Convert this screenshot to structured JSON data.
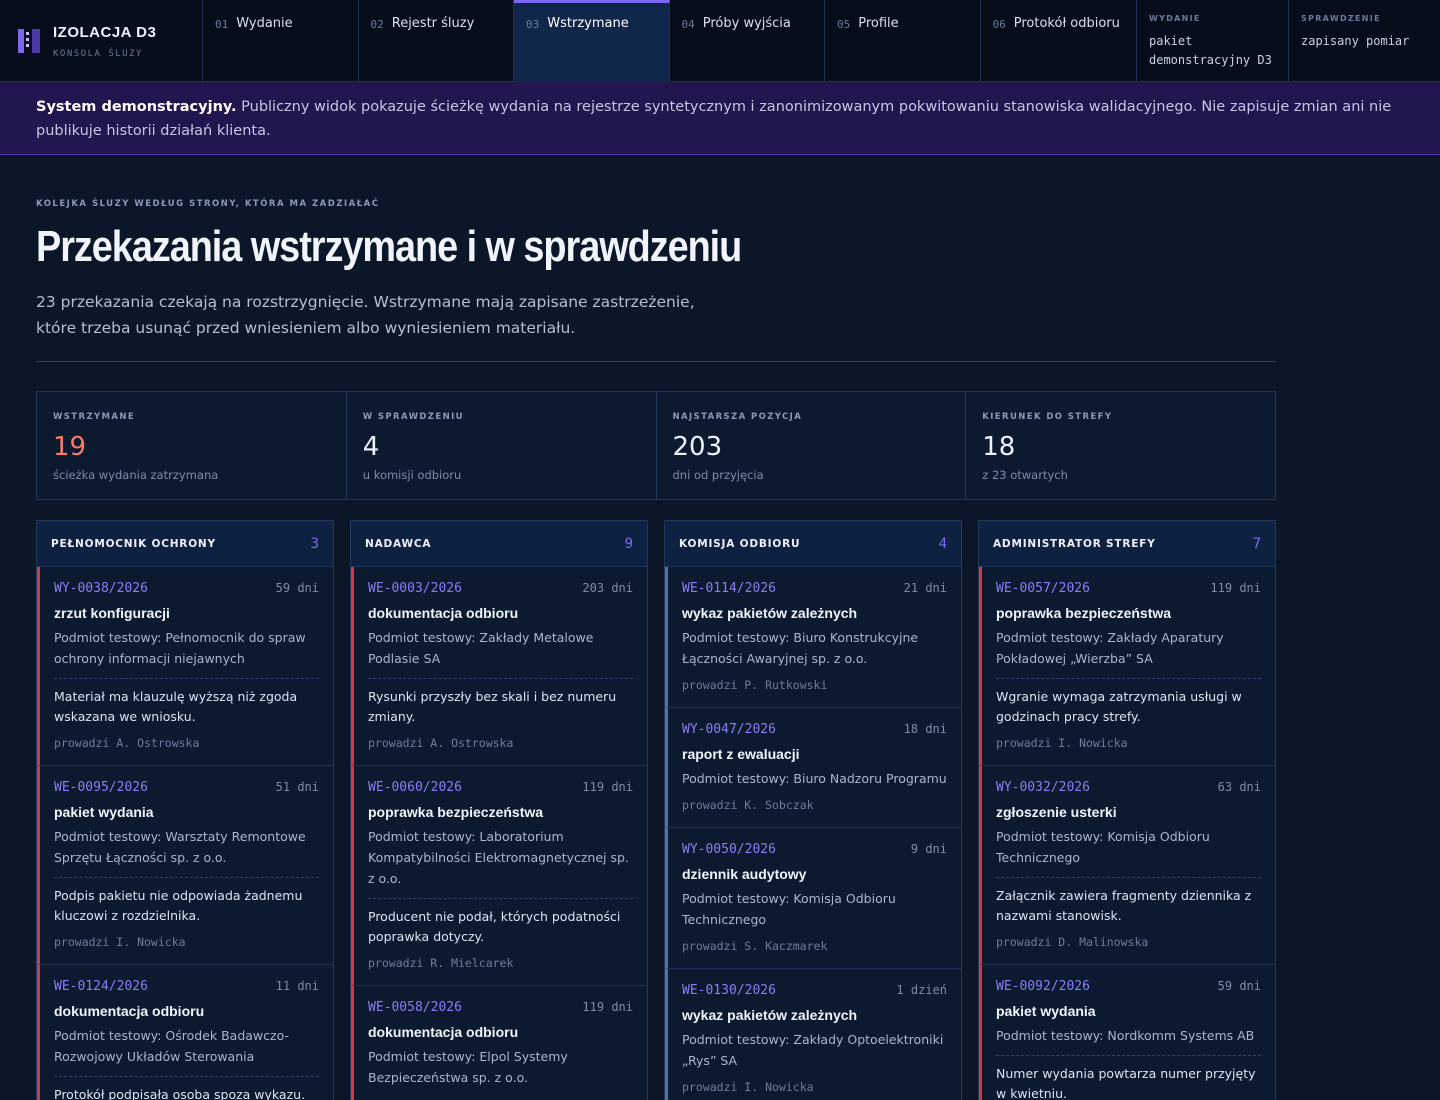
{
  "app": {
    "title": "IZOLACJA D3",
    "subtitle": "KONSOLA ŚLUZY"
  },
  "nav": {
    "tabs": [
      {
        "num": "01",
        "label": "Wydanie",
        "active": false
      },
      {
        "num": "02",
        "label": "Rejestr śluzy",
        "active": false
      },
      {
        "num": "03",
        "label": "Wstrzymane",
        "active": true
      },
      {
        "num": "04",
        "label": "Próby wyjścia",
        "active": false
      },
      {
        "num": "05",
        "label": "Profile",
        "active": false
      },
      {
        "num": "06",
        "label": "Protokół odbioru",
        "active": false
      }
    ],
    "release": {
      "label": "WYDANIE",
      "value_line1": "pakiet",
      "value_line2": "demonstracyjny D3"
    },
    "check": {
      "label": "SPRAWDZENIE",
      "value": "zapisany pomiar"
    }
  },
  "banner": {
    "strong": "System demonstracyjny.",
    "text": " Publiczny widok pokazuje ścieżkę wydania na rejestrze syntetycznym i zanonimizowanym pokwitowaniu stanowiska walidacyjnego. Nie zapisuje zmian ani nie publikuje historii działań klienta."
  },
  "page": {
    "eyebrow": "KOLEJKA ŚLUZY WEDŁUG STRONY, KTÓRA MA ZADZIAŁAĆ",
    "title": "Przekazania wstrzymane i w sprawdzeniu",
    "lead": "23 przekazania czekają na rozstrzygnięcie. Wstrzymane mają zapisane zastrzeżenie, które trzeba usunąć przed wniesieniem albo wyniesieniem materiału."
  },
  "stats": [
    {
      "label": "WSTRZYMANE",
      "value": "19",
      "sub": "ścieżka wydania zatrzymana"
    },
    {
      "label": "W SPRAWDZENIU",
      "value": "4",
      "sub": "u komisji odbioru"
    },
    {
      "label": "NAJSTARSZA POZYCJA",
      "value": "203",
      "sub": "dni od przyjęcia"
    },
    {
      "label": "KIERUNEK DO STREFY",
      "value": "18",
      "sub": "z 23 otwartych"
    }
  ],
  "columns": [
    {
      "name": "PEŁNOMOCNIK OCHRONY",
      "count": "3",
      "cards": [
        {
          "id": "WY-0038/2026",
          "age": "59 dni",
          "title": "zrzut konfiguracji",
          "subject": "Podmiot testowy: Pełnomocnik do spraw ochrony informacji niejawnych",
          "note": "Materiał ma klauzulę wyższą niż zgoda wskazana we wniosku.",
          "owner": "prowadzi A. Ostrowska"
        },
        {
          "id": "WE-0095/2026",
          "age": "51 dni",
          "title": "pakiet wydania",
          "subject": "Podmiot testowy: Warsztaty Remontowe Sprzętu Łączności sp. z o.o.",
          "note": "Podpis pakietu nie odpowiada żadnemu kluczowi z rozdzielnika.",
          "owner": "prowadzi I. Nowicka"
        },
        {
          "id": "WE-0124/2026",
          "age": "11 dni",
          "title": "dokumentacja odbioru",
          "subject": "Podmiot testowy: Ośrodek Badawczo-Rozwojowy Układów Sterowania",
          "note": "Protokół podpisała osoba spoza wykazu.",
          "owner": ""
        }
      ]
    },
    {
      "name": "NADAWCA",
      "count": "9",
      "cards": [
        {
          "id": "WE-0003/2026",
          "age": "203 dni",
          "title": "dokumentacja odbioru",
          "subject": "Podmiot testowy: Zakłady Metalowe Podlasie SA",
          "note": "Rysunki przyszły bez skali i bez numeru zmiany.",
          "owner": "prowadzi A. Ostrowska"
        },
        {
          "id": "WE-0060/2026",
          "age": "119 dni",
          "title": "poprawka bezpieczeństwa",
          "subject": "Podmiot testowy: Laboratorium Kompatybilności Elektromagnetycznej sp. z o.o.",
          "note": "Producent nie podał, których podatności poprawka dotyczy.",
          "owner": "prowadzi R. Mielcarek"
        },
        {
          "id": "WE-0058/2026",
          "age": "119 dni",
          "title": "dokumentacja odbioru",
          "subject": "Podmiot testowy: Elpol Systemy Bezpieczeństwa sp. z o.o.",
          "note": "",
          "owner": ""
        }
      ]
    },
    {
      "name": "KOMISJA ODBIORU",
      "count": "4",
      "cards": [
        {
          "id": "WE-0114/2026",
          "age": "21 dni",
          "title": "wykaz pakietów zależnych",
          "subject": "Podmiot testowy: Biuro Konstrukcyjne Łączności Awaryjnej sp. z o.o.",
          "note": "",
          "owner": "prowadzi P. Rutkowski"
        },
        {
          "id": "WY-0047/2026",
          "age": "18 dni",
          "title": "raport z ewaluacji",
          "subject": "Podmiot testowy: Biuro Nadzoru Programu",
          "note": "",
          "owner": "prowadzi K. Sobczak"
        },
        {
          "id": "WY-0050/2026",
          "age": "9 dni",
          "title": "dziennik audytowy",
          "subject": "Podmiot testowy: Komisja Odbioru Technicznego",
          "note": "",
          "owner": "prowadzi S. Kaczmarek"
        },
        {
          "id": "WE-0130/2026",
          "age": "1 dzień",
          "title": "wykaz pakietów zależnych",
          "subject": "Podmiot testowy: Zakłady Optoelektroniki „Rys” SA",
          "note": "",
          "owner": "prowadzi I. Nowicka"
        }
      ]
    },
    {
      "name": "ADMINISTRATOR STREFY",
      "count": "7",
      "cards": [
        {
          "id": "WE-0057/2026",
          "age": "119 dni",
          "title": "poprawka bezpieczeństwa",
          "subject": "Podmiot testowy: Zakłady Aparatury Pokładowej „Wierzba” SA",
          "note": "Wgranie wymaga zatrzymania usługi w godzinach pracy strefy.",
          "owner": "prowadzi I. Nowicka"
        },
        {
          "id": "WY-0032/2026",
          "age": "63 dni",
          "title": "zgłoszenie usterki",
          "subject": "Podmiot testowy: Komisja Odbioru Technicznego",
          "note": "Załącznik zawiera fragmenty dziennika z nazwami stanowisk.",
          "owner": "prowadzi D. Malinowska"
        },
        {
          "id": "WE-0092/2026",
          "age": "59 dni",
          "title": "pakiet wydania",
          "subject": "Podmiot testowy: Nordkomm Systems AB",
          "note": "Numer wydania powtarza numer przyjęty w kwietniu.",
          "owner": ""
        }
      ]
    }
  ]
}
